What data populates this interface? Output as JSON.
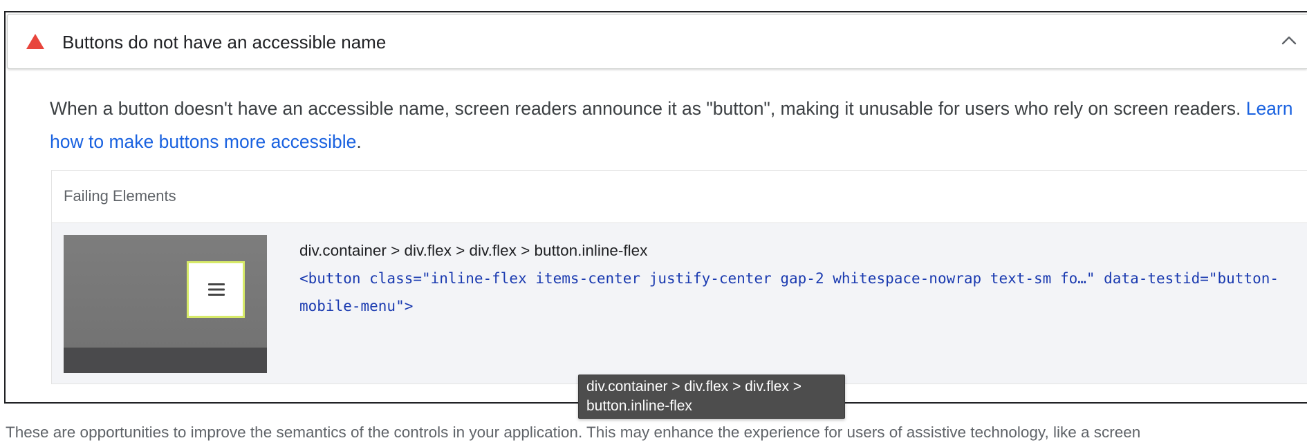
{
  "audit": {
    "title": "Buttons do not have an accessible name",
    "status_icon": "warning-triangle-icon",
    "status_color": "#e8453c",
    "expanded": true,
    "toggle_icon": "chevron-up-icon",
    "description_text": "When a button doesn't have an accessible name, screen readers announce it as \"button\", making it unusable for users who rely on screen readers. ",
    "learn_more_link": "Learn how to make buttons more accessible",
    "description_end": ".",
    "link_color": "#1a62e0"
  },
  "failing_elements": {
    "header": "Failing Elements",
    "items": [
      {
        "thumbnail_icon": "hamburger-menu-icon",
        "path": "div.container > div.flex > div.flex > button.inline-flex",
        "snippet": "<button class=\"inline-flex items-center justify-center gap-2 whitespace-nowrap text-sm fo…\" data-testid=\"button-mobile-menu\">"
      }
    ]
  },
  "tooltip": {
    "line1": "div.container > div.flex > div.flex >",
    "line2": "button.inline-flex"
  },
  "footer": {
    "text": "These are opportunities to improve the semantics of the controls in your application. This may enhance the experience for users of assistive technology, like a screen"
  }
}
